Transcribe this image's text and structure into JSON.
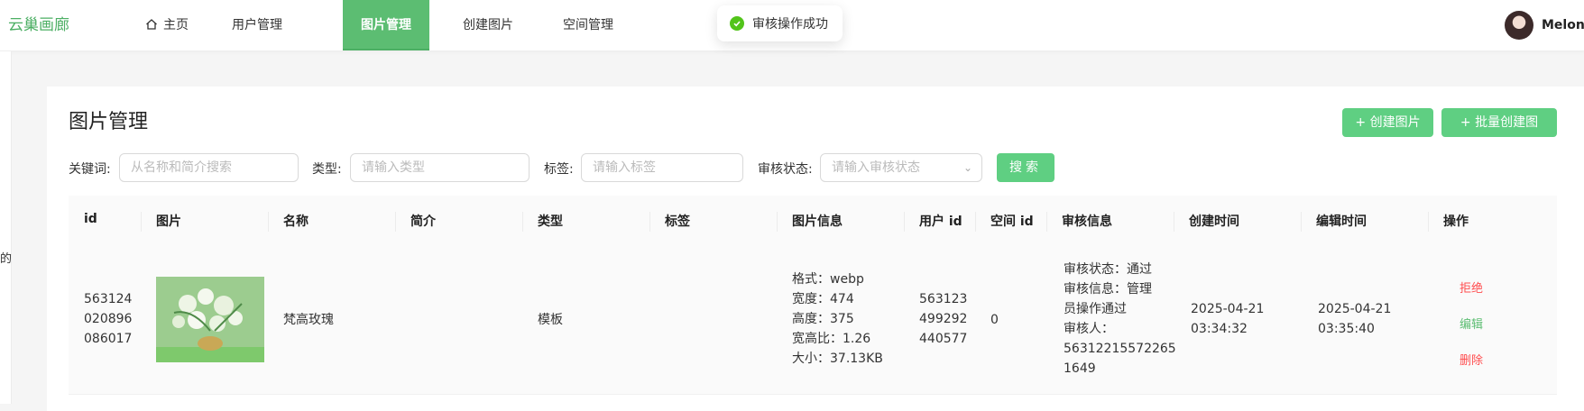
{
  "header": {
    "logo": "云巢画廊",
    "nav": [
      "主页",
      "用户管理",
      "图片管理",
      "创建图片",
      "空间管理"
    ],
    "active_nav": "图片管理",
    "username": "MelonT"
  },
  "toast": {
    "message": "审核操作成功"
  },
  "left_fragment": "的",
  "page": {
    "title": "图片管理",
    "create_btn": "+ 创建图片",
    "batch_btn": "+ 批量创建图片"
  },
  "filters": {
    "keyword_label": "关键词:",
    "keyword_placeholder": "从名称和简介搜索",
    "type_label": "类型:",
    "type_placeholder": "请输入类型",
    "tag_label": "标签:",
    "tag_placeholder": "请输入标签",
    "status_label": "审核状态:",
    "status_placeholder": "请输入审核状态",
    "search_btn": "搜索"
  },
  "table": {
    "columns": [
      "id",
      "图片",
      "名称",
      "简介",
      "类型",
      "标签",
      "图片信息",
      "用户 id",
      "空间 id",
      "审核信息",
      "创建时间",
      "编辑时间",
      "操作"
    ],
    "rows": [
      {
        "id": [
          "563124",
          "020896",
          "086017"
        ],
        "name": "梵高玫瑰",
        "intro": "",
        "type": "模板",
        "tags": "",
        "info": [
          "格式：webp",
          "宽度：474",
          "高度：375",
          "宽高比：1.26",
          "大小：37.13KB"
        ],
        "user_id": [
          "563123",
          "499292",
          "440577"
        ],
        "space_id": "0",
        "review": [
          "审核状态：通过",
          "审核信息：管理",
          "员操作通过",
          "审核人：",
          "56312215572265",
          "1649"
        ],
        "created": [
          "2025-04-21",
          "03:34:32"
        ],
        "edited": [
          "2025-04-21",
          "03:35:40"
        ],
        "actions": [
          "拒绝",
          "编辑",
          "删除"
        ]
      }
    ]
  },
  "colors": {
    "brand": "#5cbd72",
    "danger": "#ff4d4f",
    "success": "#52c41a"
  },
  "icons": {
    "home": "home-icon",
    "check": "check-circle-icon",
    "chevron": "chevron-down-icon"
  }
}
